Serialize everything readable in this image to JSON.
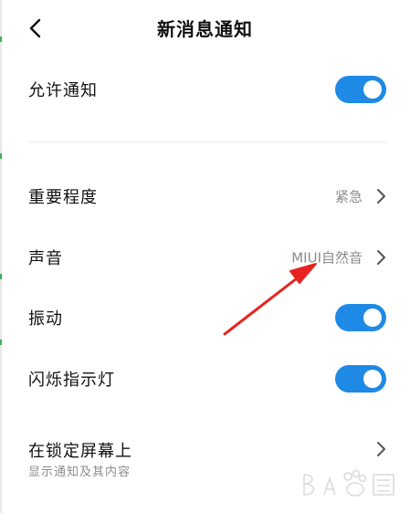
{
  "header": {
    "title": "新消息通知",
    "back_icon": "chevron-left-icon"
  },
  "settings": {
    "allow_notifications": {
      "label": "允许通知",
      "enabled": true
    },
    "importance": {
      "label": "重要程度",
      "value": "紧急"
    },
    "sound": {
      "label": "声音",
      "value": "MIUI自然音"
    },
    "vibration": {
      "label": "振动",
      "enabled": true
    },
    "indicator_light": {
      "label": "闪烁指示灯",
      "enabled": true
    },
    "lock_screen": {
      "label": "在锁定屏幕上",
      "sublabel": "显示通知及其内容"
    }
  },
  "colors": {
    "toggle_on": "#1e8ae5",
    "secondary_text": "#8c8c8c",
    "annotation_arrow": "#e8231f"
  }
}
